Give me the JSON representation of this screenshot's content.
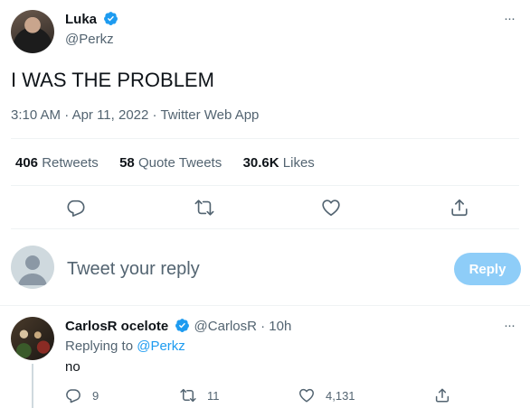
{
  "tweet": {
    "author_name": "Luka",
    "author_handle": "@Perkz",
    "text": "I WAS THE PROBLEM",
    "time": "3:10 AM",
    "separator1": "·",
    "date": "Apr 11, 2022",
    "separator2": "·",
    "source": "Twitter Web App",
    "more_glyph": "···",
    "stats": {
      "retweets_count": "406",
      "retweets_label": "Retweets",
      "quotes_count": "58",
      "quotes_label": "Quote Tweets",
      "likes_count": "30.6K",
      "likes_label": "Likes"
    },
    "actions": [
      "reply-icon",
      "retweet-icon",
      "like-icon",
      "share-icon"
    ]
  },
  "compose": {
    "placeholder": "Tweet your reply",
    "reply_button": "Reply"
  },
  "reply": {
    "author_name": "CarlosR ocelote",
    "author_handle": "@CarlosR",
    "separator": "·",
    "age": "10h",
    "more_glyph": "···",
    "replying_prefix": "Replying to",
    "replying_handle": "@Perkz",
    "text": "no",
    "reply_count": "9",
    "retweet_count": "11",
    "like_count": "4,131"
  },
  "colors": {
    "accent": "#1d9bf0",
    "reply_button_disabled": "#8ecdf8",
    "muted_text": "#536471",
    "divider": "#eff3f4"
  }
}
